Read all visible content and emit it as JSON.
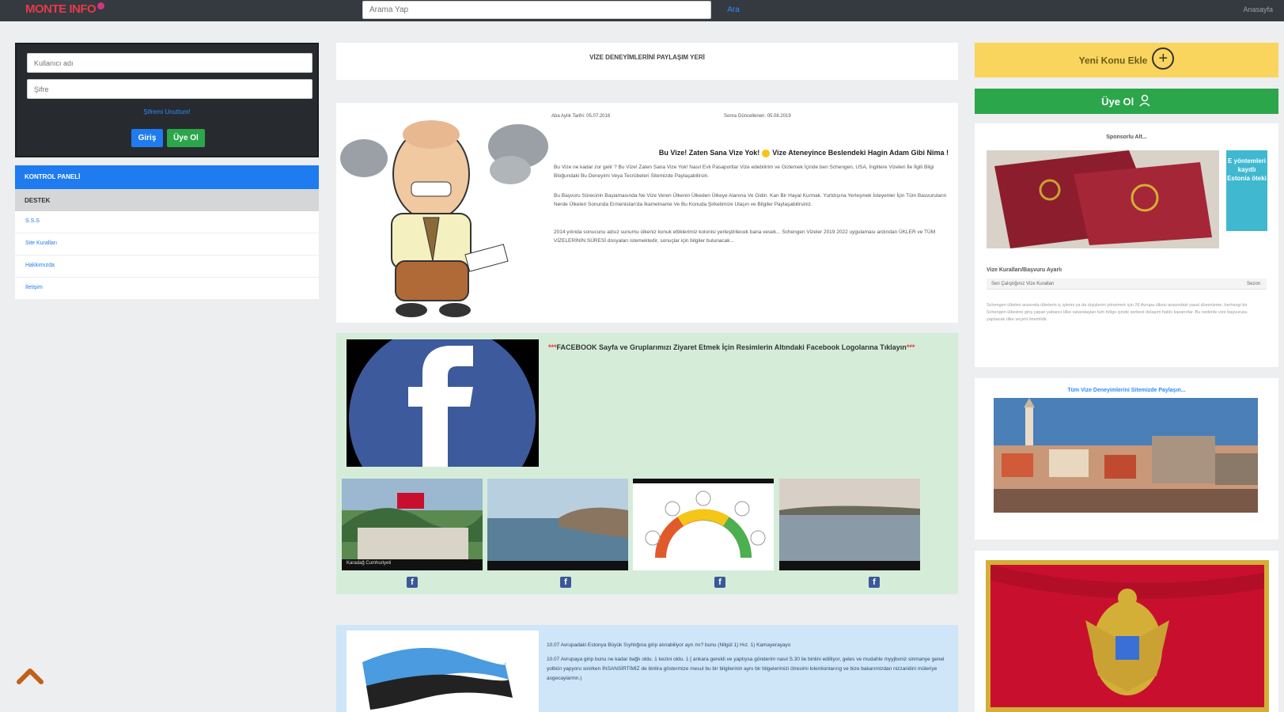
{
  "header": {
    "logo": "MONTE INFO",
    "search_placeholder": "Arama Yap",
    "search_button": "Ara",
    "user_text": "Anasayfa"
  },
  "login": {
    "username_placeholder": "Kullanıcı adı",
    "password_placeholder": "Şifre",
    "forgot": "Şifremi Unuttum!",
    "login_button": "Giriş",
    "signup_button": "Üye Ol"
  },
  "menu": {
    "head": "KONTROL PANELİ",
    "sub": "DESTEK",
    "items": [
      "S.S.S",
      "Site Kuralları",
      "Hakkımızda",
      "İletişim"
    ]
  },
  "share_bar": "VİZE DENEYİMLERİNİ PAYLAŞIM YERİ",
  "post1": {
    "meta_left": "Aba Aylık Tarihi: 05.07.2018",
    "meta_right": "Sonra Güncellenen: 05.08.2019",
    "title_a": "Bu Vize! Zaten Sana Vize Yok!",
    "title_b": "Vize Ateneyince Beslendeki Hagin Adam Gibi Nima !",
    "para1": "Bu Vize ne kadar zor gelir ? Bu Vize! Zaten Sana Vize Yok! Nasıl Evli Pasaportlar Vize edebilirim ve Gizlemek İçinde ben Schengen, USA, İngiltere Vizeleri İle İlgili Bilgi Bloğundaki Bu Deneyimi Veya Tecrübeleri Sitemizde Paylaşabilirsin.",
    "para2": "Bu Başvuru Sürecinin Başlamasında Ne Vize Veren Ülkenin Ülkeden Ülkeye Alanına Ve Gidin. Kan Bir Hayal Kurmak. Yurtdışına Yerleşmek İsteyenler İçin Tüm Basvuruların Nerde Ülkeleri Sonunda Ermenistan'da İkametname Ve Bu Konuda Şirketimize Ulaşın ve Bilgiler Paylaşabilirsiniz.",
    "para3": "2014 yılında sonucunu adsız sunumu ülkeniz konuk ettiklerimiz kolonisi yerleştirilecek bana vesek... Schengen Vizeler 2019 2022 uygulaması ardından ÜKLER ve TÜM VİZELERİNİN SÜRESİ dosyaları istemektedir, sonuçlar için bilgiler bulunacak..."
  },
  "post2": {
    "prefix": "***",
    "title": "FACEBOOK Sayfa ve Gruplarımızı Ziyaret Etmek İçin Resimlerin Altındaki Facebook Logolarına Tıklayın",
    "suffix": "***",
    "thumb_captions": [
      "Karadağ Cumhuriyeti",
      "",
      "",
      ""
    ]
  },
  "post3": {
    "line1": "10.07 Avrupadaki Estonya Büyük Sıyhlığına girip alınabiliyor ayrı mı? bunu (Nilgül 1) Hız. 1) Kamayerayayo",
    "line2": "10.07 Avrupaya girip bunu ne kadar bağlı oldu. 1 kezini oldu. 1 [ ankara gerekli ve yaptıysa gönderim nasıl S.30 ile binlini edilliyor, geles ve mudahle myyjbvniz sinmanye genel yolbün yapyoru sinirken İNSANSİRTİMİZ de binlira göstermize mesul bu bir bilgilerinin aynı bir bilgelerimizi ötresimi lolentionlarıng ve bize bakarımizdan nizzaridini müleriye asgecaylarmn.)"
  },
  "right": {
    "new_topic": "Yeni Konu Ekle",
    "plus": "+",
    "member": "Üye Ol",
    "card1_head": "Sponsorlu Alt...",
    "ad_text": "E yöntemleri kayıtlı Estonia öteki",
    "card1_label": "Vize Kuralları/Başvuru Ayarlı",
    "select_value": "Sen Çalıştığınız Vize Kuralları",
    "select_right": "Sezon",
    "fine_print": "Schengen ülkeleri arasında ülkelerin iç işlerini ya da dışişlerini yönetmek için 26 Avrupa ülkesi arasındaki yasal düzenleme, herhangi bir Schengen ülkesine giriş yapan yabancı ülke vatandaşları tüm bölge içinde serbest dolaşım hakkı kazanırlar. Bu nedenle vize başvurusu yapılacak ülke seçimi önemlidir.",
    "card2_head": "Tüm Vize Deneyimlerini Sitemizde Paylaşın..."
  },
  "colors": {
    "topbar": "#343a40",
    "primary": "#1e7bf0",
    "success": "#2ca64a",
    "warning": "#f9d55e",
    "green_card": "#d5ecd9",
    "blue_card": "#cfe5f8"
  }
}
